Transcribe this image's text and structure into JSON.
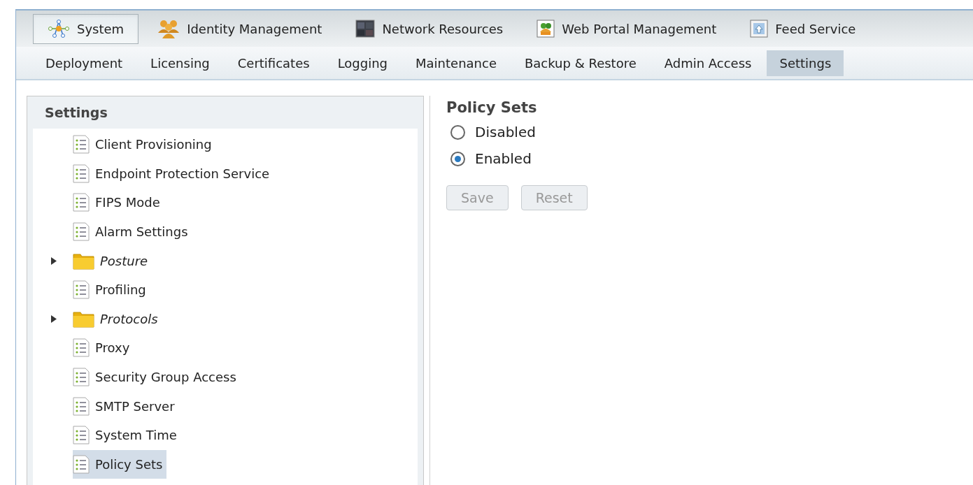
{
  "top_tabs": [
    {
      "label": "System",
      "kind": "network",
      "selected": true
    },
    {
      "label": "Identity Management",
      "kind": "people",
      "selected": false
    },
    {
      "label": "Network Resources",
      "kind": "grid",
      "selected": false
    },
    {
      "label": "Web Portal Management",
      "kind": "portal",
      "selected": false
    },
    {
      "label": "Feed Service",
      "kind": "feed",
      "selected": false
    }
  ],
  "sub_tabs": [
    {
      "label": "Deployment",
      "selected": false
    },
    {
      "label": "Licensing",
      "selected": false
    },
    {
      "label": "Certificates",
      "selected": false
    },
    {
      "label": "Logging",
      "selected": false
    },
    {
      "label": "Maintenance",
      "selected": false
    },
    {
      "label": "Backup & Restore",
      "selected": false
    },
    {
      "label": "Admin Access",
      "selected": false
    },
    {
      "label": "Settings",
      "selected": true
    }
  ],
  "sidebar": {
    "title": "Settings",
    "items": [
      {
        "label": "Client Provisioning",
        "kind": "page",
        "selected": false
      },
      {
        "label": "Endpoint Protection Service",
        "kind": "page",
        "selected": false
      },
      {
        "label": "FIPS Mode",
        "kind": "page",
        "selected": false
      },
      {
        "label": "Alarm Settings",
        "kind": "page",
        "selected": false
      },
      {
        "label": "Posture",
        "kind": "folder",
        "expanded": false,
        "selected": false
      },
      {
        "label": "Profiling",
        "kind": "page",
        "selected": false
      },
      {
        "label": "Protocols",
        "kind": "folder",
        "expanded": false,
        "selected": false
      },
      {
        "label": "Proxy",
        "kind": "page",
        "selected": false
      },
      {
        "label": "Security Group Access",
        "kind": "page",
        "selected": false
      },
      {
        "label": "SMTP Server",
        "kind": "page",
        "selected": false
      },
      {
        "label": "System Time",
        "kind": "page",
        "selected": false
      },
      {
        "label": "Policy Sets",
        "kind": "page",
        "selected": true
      }
    ]
  },
  "content": {
    "title": "Policy Sets",
    "options": [
      {
        "label": "Disabled",
        "selected": false
      },
      {
        "label": "Enabled",
        "selected": true
      }
    ],
    "buttons": [
      {
        "label": "Save",
        "disabled": true
      },
      {
        "label": "Reset",
        "disabled": true
      }
    ]
  }
}
